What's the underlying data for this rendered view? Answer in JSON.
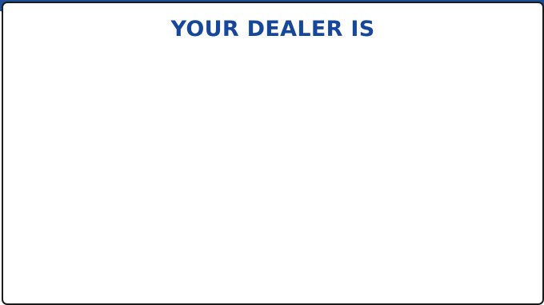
{
  "dialog": {
    "title": "YOUR DEALER IS"
  },
  "colors": {
    "title_color": "#17479a",
    "band_color": "#1d4f96",
    "panel_border": "#1b1b1b",
    "panel_background": "#ffffff"
  }
}
